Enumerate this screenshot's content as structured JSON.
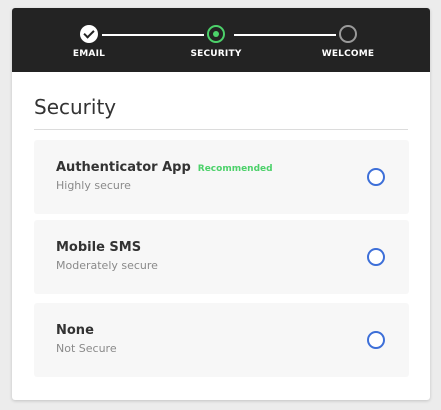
{
  "stepper": {
    "steps": [
      {
        "label": "EMAIL",
        "status": "done",
        "icon": "check-icon"
      },
      {
        "label": "SECURITY",
        "status": "active",
        "icon": "dot-icon"
      },
      {
        "label": "WELCOME",
        "status": "pending",
        "icon": "circle-icon"
      }
    ]
  },
  "section": {
    "title": "Security"
  },
  "options": [
    {
      "title": "Authenticator App",
      "badge": "Recommended",
      "subtitle": "Highly secure",
      "selected": false
    },
    {
      "title": "Mobile SMS",
      "badge": "",
      "subtitle": "Moderately secure",
      "selected": false
    },
    {
      "title": "None",
      "badge": "",
      "subtitle": "Not Secure",
      "selected": false
    }
  ],
  "colors": {
    "header_bg": "#232323",
    "accent_green": "#4cd16a",
    "radio_blue": "#3d6fd8",
    "option_bg": "#f7f7f7"
  }
}
